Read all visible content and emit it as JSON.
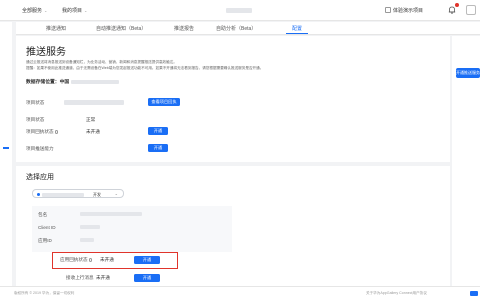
{
  "topbar": {
    "service_dropdown": "全部服务",
    "project_dropdown": "我的项目",
    "chevron": "⌄",
    "experience_project": "体验演示项目",
    "bell_icon": "bell-icon"
  },
  "tabs": [
    {
      "label": "推送通知",
      "active": false
    },
    {
      "label": "自动推送通知（Beta）",
      "active": false
    },
    {
      "label": "推送报告",
      "active": false
    },
    {
      "label": "自助分析（Beta）",
      "active": false
    },
    {
      "label": "配置",
      "active": true
    }
  ],
  "push_service": {
    "title": "推送服务",
    "desc_line1": "通过云推送将消息推送到设备通知栏，为业务活动、营销、新闻和消息提醒推送提供高效触达。",
    "desc_line2": "提醒：如果不使用此推送通道，由于无需设备在Web端为您发起推送功能不可用。如果不开通将无法看到报告。请您根据需要确认推送服务是否开通。",
    "data_location_label": "数据存储位置：中国",
    "rows": [
      {
        "label": "项目状态",
        "value": "",
        "button": "查看项目回执"
      },
      {
        "label": "项目状态",
        "value": "正常",
        "button": ""
      },
      {
        "label": "项目回执状态",
        "value": "未开通",
        "button": "开通"
      },
      {
        "label": "项目推送能力",
        "value": "",
        "button": "开通"
      }
    ],
    "side_button": "开通推送服务"
  },
  "app_config": {
    "title": "选择应用",
    "select_status": "开发",
    "fields": [
      {
        "label": "包名"
      },
      {
        "label": "Client ID"
      },
      {
        "label": "应用ID"
      }
    ],
    "highlighted_row": {
      "label": "应用回执状态",
      "value": "未开通",
      "button": "开通"
    },
    "next_row": {
      "label": "接收上行消息",
      "value": "未开通",
      "button": "开通"
    }
  },
  "footer": {
    "left": "版权所有 © 2019 华为，保留一切权利",
    "right": "关于华为AppGallery Connect用户协议"
  },
  "colors": {
    "accent": "#1a6ef5",
    "highlight": "#e0342b"
  }
}
